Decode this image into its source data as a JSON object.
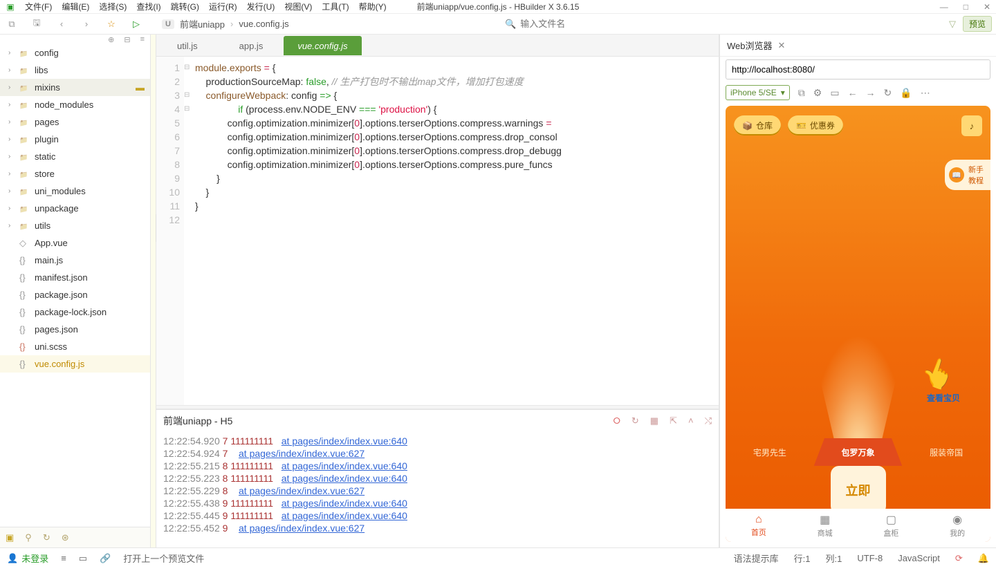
{
  "menubar": {
    "items": [
      "文件(F)",
      "编辑(E)",
      "选择(S)",
      "查找(I)",
      "跳转(G)",
      "运行(R)",
      "发行(U)",
      "视图(V)",
      "工具(T)",
      "帮助(Y)"
    ],
    "title": "前端uniapp/vue.config.js - HBuilder X 3.6.15"
  },
  "toolbar": {
    "breadcrumb": [
      "前端uniapp",
      "vue.config.js"
    ],
    "search_placeholder": "输入文件名",
    "preview": "预览"
  },
  "tree": [
    {
      "label": "config",
      "kind": "folder"
    },
    {
      "label": "libs",
      "kind": "folder"
    },
    {
      "label": "mixins",
      "kind": "folder",
      "selected": true
    },
    {
      "label": "node_modules",
      "kind": "folder"
    },
    {
      "label": "pages",
      "kind": "folder"
    },
    {
      "label": "plugin",
      "kind": "folder"
    },
    {
      "label": "static",
      "kind": "folder"
    },
    {
      "label": "store",
      "kind": "folder"
    },
    {
      "label": "uni_modules",
      "kind": "folder"
    },
    {
      "label": "unpackage",
      "kind": "folder"
    },
    {
      "label": "utils",
      "kind": "folder"
    },
    {
      "label": "App.vue",
      "kind": "vue"
    },
    {
      "label": "main.js",
      "kind": "js"
    },
    {
      "label": "manifest.json",
      "kind": "json"
    },
    {
      "label": "package.json",
      "kind": "json"
    },
    {
      "label": "package-lock.json",
      "kind": "json"
    },
    {
      "label": "pages.json",
      "kind": "json"
    },
    {
      "label": "uni.scss",
      "kind": "scss"
    },
    {
      "label": "vue.config.js",
      "kind": "js",
      "active": true
    }
  ],
  "tabs": [
    {
      "label": "util.js"
    },
    {
      "label": "app.js"
    },
    {
      "label": "vue.config.js",
      "active": true
    }
  ],
  "code": {
    "lines": [
      "1",
      "2",
      "3",
      "4",
      "5",
      "6",
      "7",
      "8",
      "9",
      "10",
      "11",
      "12"
    ],
    "l1a": "module",
    "l1b": ".",
    "l1c": "exports",
    "l1d": " = {",
    "l2a": "    productionSourceMap: ",
    "l2b": "false",
    "l2c": ", ",
    "l2d": "// 生产打包时不输出map文件，增加打包速度",
    "l3a": "    configureWebpack",
    "l3b": ": config ",
    "l3c": "=>",
    "l3d": " {",
    "l4a": "        if",
    "l4b": " (process.env.NODE_ENV ",
    "l4c": "===",
    "l4d": " 'production'",
    "l4e": ") {",
    "l5a": "            config.optimization.minimizer[",
    "l5b": "0",
    "l5c": "].options.terserOptions.compress.warnings ",
    "l5d": "=",
    "l6a": "            config.optimization.minimizer[",
    "l6b": "0",
    "l6c": "].options.terserOptions.compress.drop_consol",
    "l7a": "            config.optimization.minimizer[",
    "l7b": "0",
    "l7c": "].options.terserOptions.compress.drop_debugg",
    "l8a": "            config.optimization.minimizer[",
    "l8b": "0",
    "l8c": "].options.terserOptions.compress.pure_funcs",
    "l9": "        }",
    "l10": "    }",
    "l11": "}"
  },
  "console": {
    "title": "前端uniapp - H5",
    "rows": [
      {
        "ts": "12:22:54.920",
        "ord": "7",
        "msg": "111111111",
        "trace": "at pages/index/index.vue:640"
      },
      {
        "ts": "12:22:54.924",
        "ord": "7",
        "msg": "",
        "trace": "at pages/index/index.vue:627"
      },
      {
        "ts": "12:22:55.215",
        "ord": "8",
        "msg": "111111111",
        "trace": "at pages/index/index.vue:640"
      },
      {
        "ts": "12:22:55.223",
        "ord": "8",
        "msg": "111111111",
        "trace": "at pages/index/index.vue:640"
      },
      {
        "ts": "12:22:55.229",
        "ord": "8",
        "msg": "",
        "trace": "at pages/index/index.vue:627"
      },
      {
        "ts": "12:22:55.438",
        "ord": "9",
        "msg": "111111111",
        "trace": "at pages/index/index.vue:640"
      },
      {
        "ts": "12:22:55.445",
        "ord": "9",
        "msg": "111111111",
        "trace": "at pages/index/index.vue:640"
      },
      {
        "ts": "12:22:55.452",
        "ord": "9",
        "msg": "",
        "trace": "at pages/index/index.vue:627"
      }
    ]
  },
  "preview": {
    "tab": "Web浏览器",
    "url": "http://localhost:8080/",
    "device": "iPhone 5/SE",
    "btn_cangku": "仓库",
    "btn_coupon": "优惠券",
    "newbie": "新手\n教程",
    "look": "查看宝贝",
    "cat_l": "宅男先生",
    "cat_m": "包罗万象",
    "cat_r": "服装帝国",
    "go": "立即",
    "nav": [
      {
        "l": "首页",
        "on": true
      },
      {
        "l": "商城"
      },
      {
        "l": "盒柜"
      },
      {
        "l": "我的"
      }
    ]
  },
  "status": {
    "login": "未登录",
    "tip": "打开上一个预览文件",
    "lang_hint": "语法提示库",
    "row": "行:1",
    "col": "列:1",
    "enc": "UTF-8",
    "lang": "JavaScript"
  }
}
